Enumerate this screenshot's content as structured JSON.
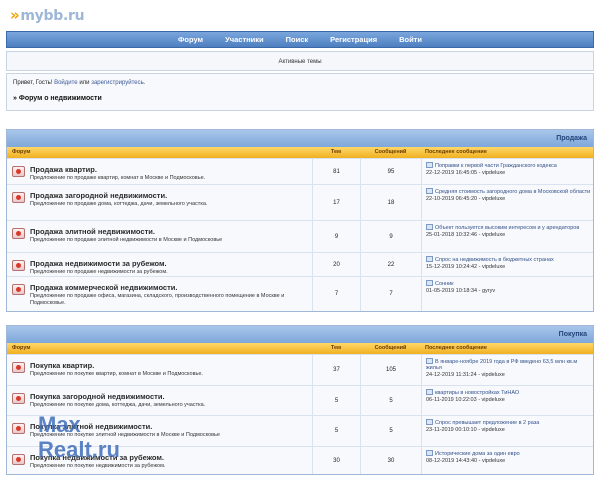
{
  "logo": {
    "arrows": "»",
    "text": "mybb.ru"
  },
  "nav": [
    "Форум",
    "Участники",
    "Поиск",
    "Регистрация",
    "Войти"
  ],
  "subbar": "Активные темы",
  "welcome": {
    "greet": "Привет, Гость!",
    "login": "Войдите",
    "or": "или",
    "register": "зарегистрируйтесь.",
    "crumb": "» Форум о недвижимости"
  },
  "columns": {
    "forum": "Форум",
    "topics": "Тем",
    "posts": "Сообщений",
    "last": "Последнее сообщение"
  },
  "categories": [
    {
      "title": "Продажа",
      "forums": [
        {
          "name": "Продажа квартир.",
          "desc": "Предложение по продаже квартир, комнат в Москве и Подмосковье.",
          "topics": "81",
          "posts": "95",
          "last_title": "Поправки к первой части Гражданского кодекса",
          "last_meta": "22-12-2019 16:45:05 - vipdeluxe"
        },
        {
          "name": "Продажа загородной недвижимости.",
          "desc": "Предложение по продаже дома, коттеджа, дачи, земельного участка.",
          "topics": "17",
          "posts": "18",
          "last_title": "Средняя стоимость загородного дома в Московской области",
          "last_meta": "22-10-2019 06:45:20 - vipdeluxe"
        },
        {
          "name": "Продажа элитной недвижимости.",
          "desc": "Предложение по продаже элитной недвижимости в Москве и Подмосковье",
          "topics": "9",
          "posts": "9",
          "last_title": "Объект пользуется высоким интересом и у арендаторов",
          "last_meta": "25-01-2018 10:32:46 - vipdeluxe"
        },
        {
          "name": "Продажа недвижимости за рубежом.",
          "desc": "Предложение по продаже недвижимости за рубежом.",
          "topics": "20",
          "posts": "22",
          "last_title": "Спрос на недвижимость в бюджетных странах",
          "last_meta": "15-12-2019 10:24:42 - vipdeluxe"
        },
        {
          "name": "Продажа коммерческой недвижимости.",
          "desc": "Предложение по продаже офиса, магазина, складского, производственного помещение в Москве и Подмосковье.",
          "topics": "7",
          "posts": "7",
          "last_title": "Сонник",
          "last_meta": "01-05-2019 10:18:34 - gyryv"
        }
      ]
    },
    {
      "title": "Покупка",
      "forums": [
        {
          "name": "Покупка квартир.",
          "desc": "Предложение по покупке квартир, комнат в Москве и Подмосковье.",
          "topics": "37",
          "posts": "105",
          "last_title": "В январе-ноябре 2019 года в РФ введено 63,5 млн кв.м жилья",
          "last_meta": "24-12-2019 11:31:24 - vipdeluxe"
        },
        {
          "name": "Покупка загородной недвижимости.",
          "desc": "Предложение по покупке дома, коттеджа, дачи, земельного участка.",
          "topics": "5",
          "posts": "5",
          "last_title": "квартиры в новостройках ТиНАО",
          "last_meta": "06-11-2019 10:22:03 - vipdeluxe"
        },
        {
          "name": "Покупка элитной недвижимости.",
          "desc": "Предложение по покупке элитной недвижимости в Москве и Подмосковье",
          "topics": "5",
          "posts": "5",
          "last_title": "Спрос превышает предложение в 2 раза",
          "last_meta": "23-11-2019 00:10:10 - vipdeluxe"
        },
        {
          "name": "Покупка недвижимости за рубежом.",
          "desc": "Предложение по покупке недвижимости за рубежом.",
          "topics": "30",
          "posts": "30",
          "last_title": "Исторические дома за один евро",
          "last_meta": "08-12-2019 14:43:40 - vipdeluxe"
        }
      ]
    }
  ],
  "watermark": {
    "line1": "Max",
    "line2": "Realt.ru"
  }
}
